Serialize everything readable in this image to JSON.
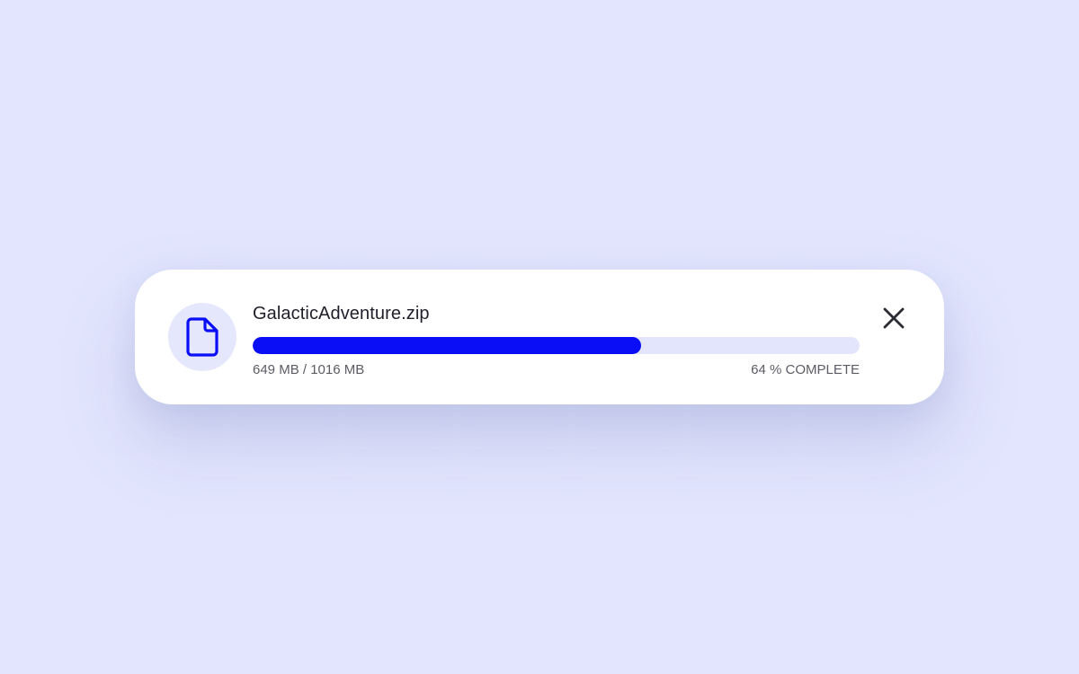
{
  "download": {
    "file_name": "GalacticAdventure.zip",
    "size_progress": "649 MB / 1016 MB",
    "percent_label": "64 % COMPLETE",
    "progress_fraction": 0.64
  },
  "icons": {
    "file": "file-icon",
    "close": "close-icon"
  },
  "colors": {
    "background": "#e2e5fd",
    "accent": "#0a0ef6",
    "track": "#e2e5fb",
    "icon_circle": "#e5e8fd"
  }
}
